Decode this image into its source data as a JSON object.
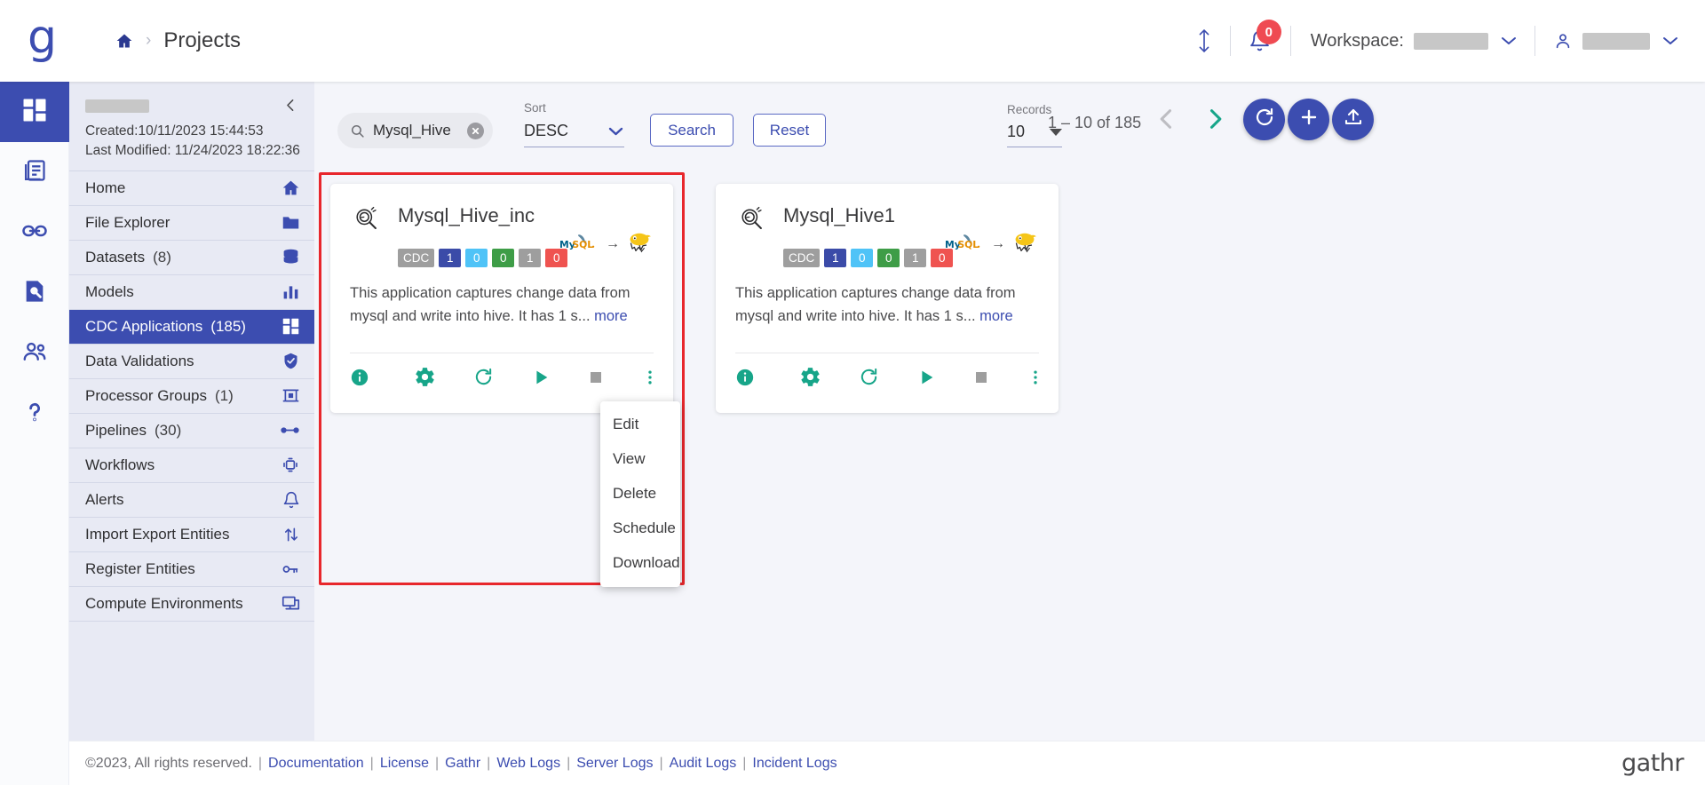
{
  "header": {
    "brand_letter": "g",
    "breadcrumb_home_icon": "home-icon",
    "breadcrumb_separator": "›",
    "breadcrumb_current": "Projects",
    "sort_toggle_icon": "sort-vertical-icon",
    "notification_icon": "bell-icon",
    "notification_count": "0",
    "workspace_label": "Workspace:",
    "workspace_value": "",
    "user_icon": "person-icon",
    "user_value": "",
    "chevron_icon": "chevron-down-icon"
  },
  "rail": {
    "items": [
      {
        "name": "dashboard",
        "icon": "grid-icon",
        "active": true
      },
      {
        "name": "projects",
        "icon": "books-icon",
        "active": false
      },
      {
        "name": "connections",
        "icon": "link-icon",
        "active": false
      },
      {
        "name": "explore",
        "icon": "file-search-icon",
        "active": false
      },
      {
        "name": "users",
        "icon": "people-icon",
        "active": false
      },
      {
        "name": "help",
        "icon": "question-mark-icon",
        "active": false
      }
    ]
  },
  "sidebar": {
    "project_name": "",
    "collapse_icon": "chevron-left-icon",
    "created": "Created:10/11/2023 15:44:53",
    "last_modified": "Last Modified: 11/24/2023 18:22:36",
    "items": [
      {
        "label": "Home",
        "count": "",
        "icon": "home-icon",
        "active": false
      },
      {
        "label": "File Explorer",
        "count": "",
        "icon": "folder-icon",
        "active": false
      },
      {
        "label": "Datasets",
        "count": "(8)",
        "icon": "database-icon",
        "active": false
      },
      {
        "label": "Models",
        "count": "",
        "icon": "bar-chart-icon",
        "active": false
      },
      {
        "label": "CDC Applications",
        "count": "(185)",
        "icon": "grid-icon",
        "active": true
      },
      {
        "label": "Data Validations",
        "count": "",
        "icon": "shield-check-icon",
        "active": false
      },
      {
        "label": "Processor Groups",
        "count": "(1)",
        "icon": "processor-icon",
        "active": false
      },
      {
        "label": "Pipelines",
        "count": "(30)",
        "icon": "pipeline-icon",
        "active": false
      },
      {
        "label": "Workflows",
        "count": "",
        "icon": "workflow-icon",
        "active": false
      },
      {
        "label": "Alerts",
        "count": "",
        "icon": "bell-icon",
        "active": false
      },
      {
        "label": "Import Export Entities",
        "count": "",
        "icon": "arrows-up-down-icon",
        "active": false
      },
      {
        "label": "Register Entities",
        "count": "",
        "icon": "key-icon",
        "active": false
      },
      {
        "label": "Compute Environments",
        "count": "",
        "icon": "monitor-icon",
        "active": false
      }
    ]
  },
  "toolbar": {
    "search_value": "Mysql_Hive",
    "search_placeholder": "Search",
    "search_icon": "search-icon",
    "clear_icon": "clear-circle-icon",
    "sort_label": "Sort",
    "sort_value": "DESC",
    "search_button": "Search",
    "reset_button": "Reset",
    "records_label": "Records",
    "records_value": "10",
    "range_text": "1 – 10 of 185",
    "prev_icon": "chevron-left-icon",
    "next_icon": "chevron-right-icon",
    "refresh_icon": "refresh-icon",
    "add_icon": "plus-icon",
    "upload_icon": "upload-icon"
  },
  "cards": [
    {
      "title": "Mysql_Hive_inc",
      "logo_icon": "cdc-magnifier-icon",
      "chips": [
        {
          "text": "CDC",
          "color": "#9e9e9e"
        },
        {
          "text": "1",
          "color": "#3b4ba8"
        },
        {
          "text": "0",
          "color": "#4fc3f7"
        },
        {
          "text": "0",
          "color": "#3e9d47"
        },
        {
          "text": "1",
          "color": "#9e9e9e"
        },
        {
          "text": "0",
          "color": "#ef5350"
        }
      ],
      "source_logo": "mysql-logo",
      "arrow": "→",
      "target_logo": "hive-logo",
      "description": "This application captures change data from mysql and write into hive. It has 1 s...",
      "more_label": "more",
      "actions": [
        {
          "name": "info-icon",
          "color": "#17a589"
        },
        {
          "name": "gear-icon",
          "color": "#17a589"
        },
        {
          "name": "refresh-icon",
          "color": "#17a589"
        },
        {
          "name": "play-icon",
          "color": "#17a589"
        },
        {
          "name": "stop-icon",
          "color": "#9e9e9e"
        },
        {
          "name": "more-vertical-icon",
          "color": "#17a589"
        }
      ]
    },
    {
      "title": "Mysql_Hive1",
      "logo_icon": "cdc-magnifier-icon",
      "chips": [
        {
          "text": "CDC",
          "color": "#9e9e9e"
        },
        {
          "text": "1",
          "color": "#3b4ba8"
        },
        {
          "text": "0",
          "color": "#4fc3f7"
        },
        {
          "text": "0",
          "color": "#3e9d47"
        },
        {
          "text": "1",
          "color": "#9e9e9e"
        },
        {
          "text": "0",
          "color": "#ef5350"
        }
      ],
      "source_logo": "mysql-logo",
      "arrow": "→",
      "target_logo": "hive-logo",
      "description": "This application captures change data from mysql and write into hive. It has 1 s...",
      "more_label": "more",
      "actions": [
        {
          "name": "info-icon",
          "color": "#17a589"
        },
        {
          "name": "gear-icon",
          "color": "#17a589"
        },
        {
          "name": "refresh-icon",
          "color": "#17a589"
        },
        {
          "name": "play-icon",
          "color": "#17a589"
        },
        {
          "name": "stop-icon",
          "color": "#9e9e9e"
        },
        {
          "name": "more-vertical-icon",
          "color": "#17a589"
        }
      ]
    }
  ],
  "context_menu": {
    "items": [
      "Edit",
      "View",
      "Delete",
      "Schedule",
      "Download"
    ]
  },
  "footer": {
    "copyright": "©2023, All rights reserved.",
    "divider": "|",
    "links": [
      "Documentation",
      "License",
      "Gathr",
      "Web Logs",
      "Server Logs",
      "Audit Logs",
      "Incident Logs"
    ],
    "logo_text": "gathr"
  },
  "colors": {
    "brand_blue": "#3c4db0",
    "accent_teal": "#17a589",
    "highlight_red": "#e8272c",
    "badge_red": "#ef4a52",
    "sidebar_bg": "#e8eaf4",
    "page_bg": "#f4f5fa"
  }
}
